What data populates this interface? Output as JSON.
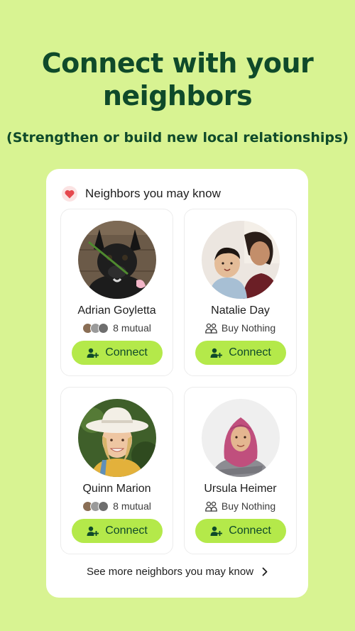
{
  "promo": {
    "headline_line1": "Connect with your",
    "headline_line2": "neighbors",
    "subhead": "(Strengthen or build new local relationships)"
  },
  "panel": {
    "title": "Neighbors you may know",
    "see_more": "See more neighbors you may know",
    "cards": [
      {
        "name": "Adrian Goyletta",
        "meta": "8 mutual",
        "meta_type": "mutual",
        "button": "Connect"
      },
      {
        "name": "Natalie Day",
        "meta": "Buy Nothing",
        "meta_type": "group",
        "button": "Connect"
      },
      {
        "name": "Quinn Marion",
        "meta": "8 mutual",
        "meta_type": "mutual",
        "button": "Connect"
      },
      {
        "name": "Ursula Heimer",
        "meta": "Buy Nothing",
        "meta_type": "group",
        "button": "Connect"
      }
    ]
  },
  "colors": {
    "background": "#d8f392",
    "headline": "#0f4a2a",
    "button": "#b4e94a",
    "heart": "#e5484d"
  },
  "icons": {
    "header": "heart-icon",
    "button": "add-person-icon",
    "group": "group-icon",
    "see_more": "chevron-right-icon"
  }
}
